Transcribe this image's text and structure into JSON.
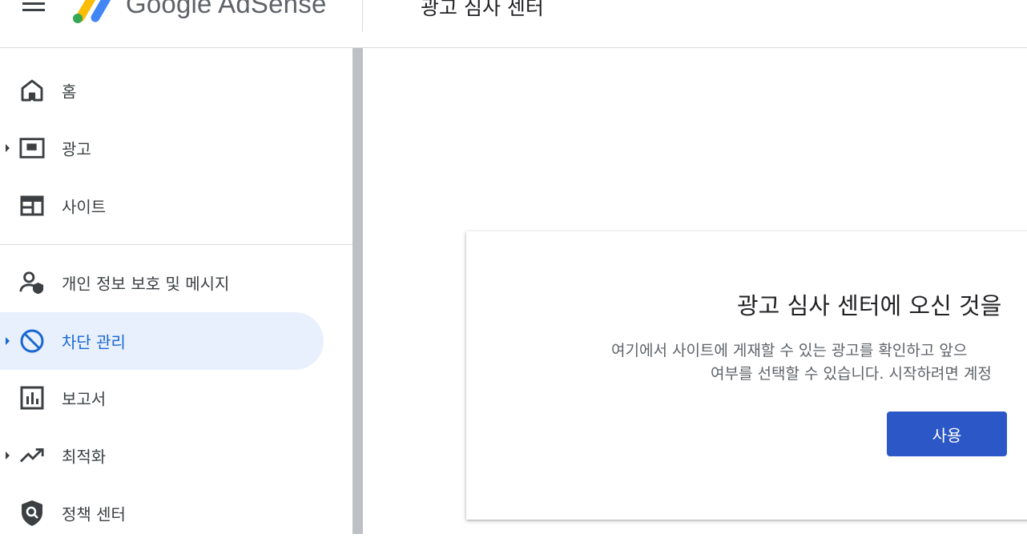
{
  "header": {
    "product_name": "Google AdSense",
    "page_title": "광고 심사 센터"
  },
  "sidebar": {
    "items": [
      {
        "label": "홈",
        "icon": "home-icon",
        "has_caret": false,
        "active": false
      },
      {
        "label": "광고",
        "icon": "ads-icon",
        "has_caret": true,
        "active": false
      },
      {
        "label": "사이트",
        "icon": "sites-icon",
        "has_caret": false,
        "active": false
      },
      {
        "label": "개인 정보 보호 및 메시지",
        "icon": "privacy-messaging-icon",
        "has_caret": false,
        "active": false
      },
      {
        "label": "차단 관리",
        "icon": "block-icon",
        "has_caret": true,
        "active": true
      },
      {
        "label": "보고서",
        "icon": "reports-icon",
        "has_caret": false,
        "active": false
      },
      {
        "label": "최적화",
        "icon": "trending-up-icon",
        "has_caret": true,
        "active": false
      },
      {
        "label": "정책 센터",
        "icon": "policy-shield-icon",
        "has_caret": false,
        "active": false
      }
    ]
  },
  "main": {
    "card": {
      "title": "광고 심사 센터에 오신 것을",
      "description_line1": "여기에서 사이트에 게재할 수 있는 광고를 확인하고 앞으",
      "description_line2": "여부를 선택할 수 있습니다. 시작하려면 계정",
      "button_label": "사용"
    }
  },
  "colors": {
    "accent": "#1967d2",
    "active_bg": "#e8f0fe",
    "button_bg": "#2c57c7"
  }
}
